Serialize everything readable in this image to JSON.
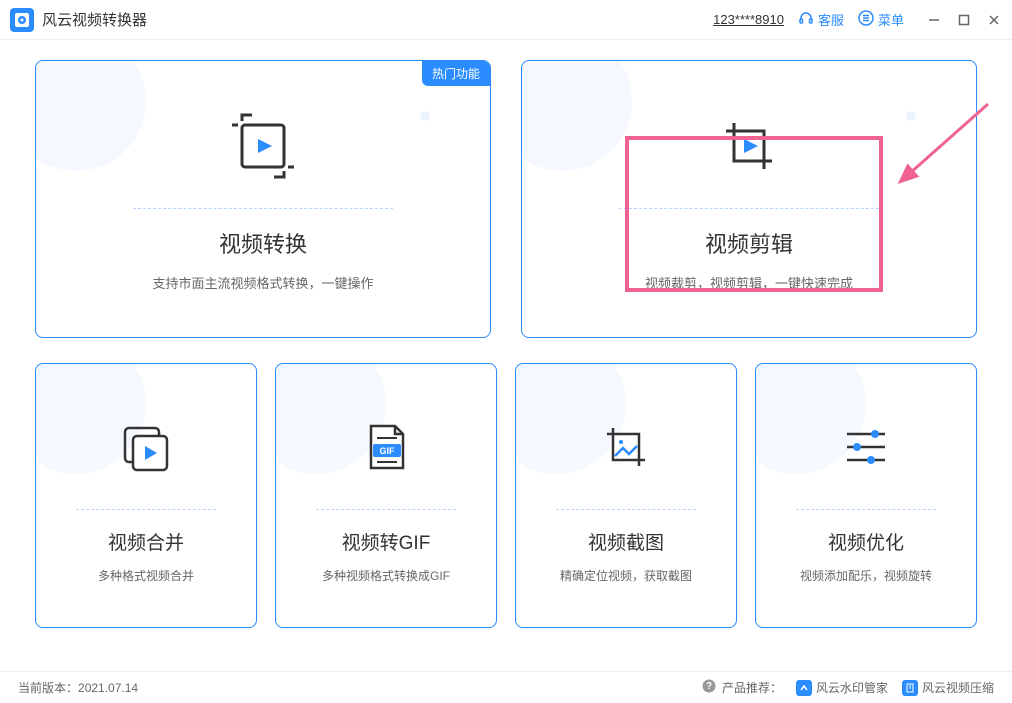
{
  "app": {
    "title": "风云视频转换器"
  },
  "header": {
    "phone": "123****8910",
    "support": "客服",
    "menu": "菜单"
  },
  "cards": {
    "hot_badge": "热门功能",
    "c0": {
      "title": "视频转换",
      "desc": "支持市面主流视频格式转换，一键操作"
    },
    "c1": {
      "title": "视频剪辑",
      "desc": "视频裁剪，视频剪辑，一键快速完成"
    },
    "c2": {
      "title": "视频合并",
      "desc": "多种格式视频合并"
    },
    "c3": {
      "title": "视频转GIF",
      "desc": "多种视频格式转换成GIF",
      "gif_label": "GIF"
    },
    "c4": {
      "title": "视频截图",
      "desc": "精确定位视频，获取截图"
    },
    "c5": {
      "title": "视频优化",
      "desc": "视频添加配乐，视频旋转"
    }
  },
  "footer": {
    "version_label": "当前版本：",
    "version": "2021.07.14",
    "recommend_label": "产品推荐：",
    "rec1": "风云水印管家",
    "rec2": "风云视频压缩"
  }
}
